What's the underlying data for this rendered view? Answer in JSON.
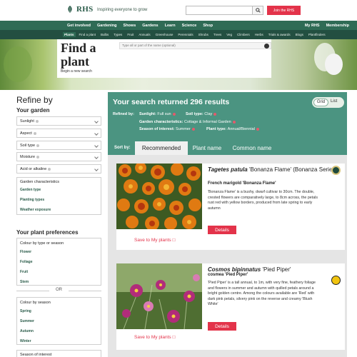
{
  "header": {
    "logo_text": "RHS",
    "tagline": "Inspiring everyone to grow",
    "search_placeholder": "",
    "join_label": "Join the RHS"
  },
  "nav_main": [
    "Get involved",
    "Gardening",
    "Shows",
    "Gardens",
    "Learn",
    "Science",
    "Shop"
  ],
  "nav_main_right": [
    "My RHS",
    "Membership"
  ],
  "nav_sub": [
    "Plants",
    "Find a plant",
    "Bulbs",
    "Types",
    "Fruit",
    "Annuals",
    "Greenhouse",
    "Perennials",
    "Shrubs",
    "Trees",
    "Veg",
    "Climbers",
    "Herbs",
    "Trials & awards",
    "Blogs",
    "Plantfinders"
  ],
  "hero": {
    "title": "Find a plant",
    "search_placeholder": "Type all or part of the name (optional)",
    "new_search": "Begin a new search"
  },
  "sidebar": {
    "title": "Refine by",
    "your_garden": "Your garden",
    "garden_filters": [
      "Sunlight",
      "Aspect",
      "Soil type",
      "Moisture",
      "Acid or alkaline"
    ],
    "garden_char": {
      "label": "Garden characteristics",
      "subs": [
        "Garden type",
        "Planting types",
        "Weather exposure"
      ]
    },
    "your_prefs": "Your plant preferences",
    "colour_type": {
      "label": "Colour by type or season",
      "subs": [
        "Flower",
        "Foliage",
        "Fruit",
        "Stem"
      ]
    },
    "or_label": "OR",
    "colour_season": {
      "label": "Colour by season",
      "subs": [
        "Spring",
        "Summer",
        "Autumn",
        "Winter"
      ]
    },
    "season_interest": "Season of interest"
  },
  "results": {
    "title": "Your search returned 296 results",
    "view_grid": "Grid",
    "view_list": "List",
    "refined_by": "Refined by:",
    "chips": {
      "sunlight_key": "Sunlight:",
      "sunlight_val": "Full sun",
      "soil_key": "Soil type:",
      "soil_val": "Clay",
      "gardenchar_key": "Garden characteristics:",
      "gardenchar_val": "Cottage & Informal Garden",
      "season_key": "Season of interest:",
      "season_val": "Summer",
      "planttype_key": "Plant type:",
      "planttype_val": "Annual/Biennial"
    },
    "sort_by": "Sort by:",
    "tabs": [
      "Recommended",
      "Plant name",
      "Common name"
    ]
  },
  "cards": [
    {
      "latin": "Tagetes patula",
      "cultivar": "'Bonanza Flame' (Bonanza Series)",
      "common": "French marigold 'Bonanza Flame'",
      "desc": "'Bonanza Flame' is a bushy, dwarf cultivar to 30cm. The double, crested flowers are comparatively large, to 8cm across, the petals rust red with yellow borders, produced from late spring to early autumn",
      "details": "Details",
      "save": "Save to My plants"
    },
    {
      "latin": "Cosmos bipinnatus",
      "cultivar": "'Pied Piper'",
      "common": "cosmea 'Pied Piper'",
      "desc": "'Pied Piper' is a tall annual, to 1m, with very fine, feathery foliage and flowers in summer and autumn with quilled petals around a bright golden centre. Among the colours available are 'Red' with dark pink petals, silvery pink on the reverse and creamy 'Blush White'",
      "details": "Details",
      "save": "Save to My plants"
    }
  ],
  "colors": {
    "brand_green": "#2f6b55",
    "results_teal": "#4b9481",
    "accent_red": "#e3334a"
  }
}
